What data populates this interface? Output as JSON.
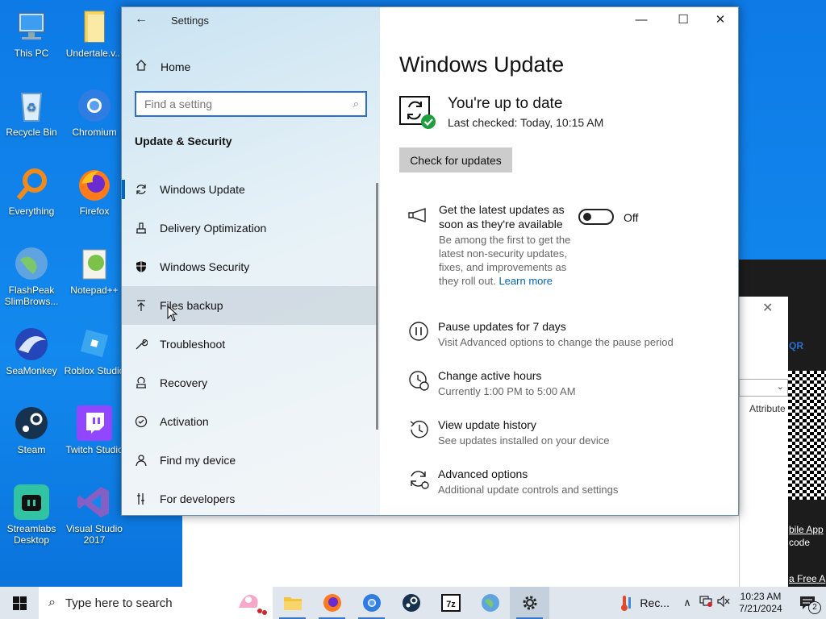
{
  "desktop": {
    "icons": [
      {
        "label": "This PC"
      },
      {
        "label": "Undertale.v..."
      },
      {
        "label": "Recycle Bin"
      },
      {
        "label": "Chromium"
      },
      {
        "label": "Everything"
      },
      {
        "label": "Firefox"
      },
      {
        "label": "FlashPeak SlimBrows..."
      },
      {
        "label": "Notepad++"
      },
      {
        "label": "SeaMonkey"
      },
      {
        "label": "Roblox Studio"
      },
      {
        "label": "Steam"
      },
      {
        "label": "Twitch Studio"
      },
      {
        "label": "Streamlabs Desktop"
      },
      {
        "label": "Visual Studio 2017"
      }
    ]
  },
  "background": {
    "qr_label": "QR",
    "attribute_label": "Attribute",
    "mobile_app": "bile App",
    "code": "code",
    "free": "a Free A"
  },
  "settings": {
    "title": "Settings",
    "home_label": "Home",
    "search_placeholder": "Find a setting",
    "section_title": "Update & Security",
    "nav": [
      {
        "label": "Windows Update",
        "icon": "refresh-icon"
      },
      {
        "label": "Delivery Optimization",
        "icon": "delivery-icon"
      },
      {
        "label": "Windows Security",
        "icon": "shield-icon"
      },
      {
        "label": "Files backup",
        "icon": "upload-icon"
      },
      {
        "label": "Troubleshoot",
        "icon": "wrench-icon"
      },
      {
        "label": "Recovery",
        "icon": "recovery-icon"
      },
      {
        "label": "Activation",
        "icon": "check-circle-icon"
      },
      {
        "label": "Find my device",
        "icon": "person-pin-icon"
      },
      {
        "label": "For developers",
        "icon": "developer-icon"
      }
    ],
    "main": {
      "page_title": "Windows Update",
      "status_title": "You're up to date",
      "status_sub": "Last checked: Today, 10:15 AM",
      "check_button": "Check for updates",
      "latest_title": "Get the latest updates as soon as they're available",
      "latest_desc": "Be among the first to get the latest non-security updates, fixes, and improvements as they roll out.",
      "learn_more": "Learn more",
      "toggle_label": "Off",
      "options": [
        {
          "title": "Pause updates for 7 days",
          "sub": "Visit Advanced options to change the pause period"
        },
        {
          "title": "Change active hours",
          "sub": "Currently 1:00 PM to 5:00 AM"
        },
        {
          "title": "View update history",
          "sub": "See updates installed on your device"
        },
        {
          "title": "Advanced options",
          "sub": "Additional update controls and settings"
        }
      ]
    }
  },
  "taskbar": {
    "search_placeholder": "Type here to search",
    "apps": [
      "File Explorer",
      "Firefox",
      "Chromium",
      "Steam",
      "7-Zip",
      "SlimBrowser",
      "Settings"
    ],
    "running_label": "Rec...",
    "time": "10:23 AM",
    "date": "7/21/2024",
    "notification_count": "2"
  },
  "colors": {
    "accent": "#0067c0",
    "desktop_bg": "#1289ee",
    "success": "#1e9e3e",
    "link": "#0063b1"
  }
}
